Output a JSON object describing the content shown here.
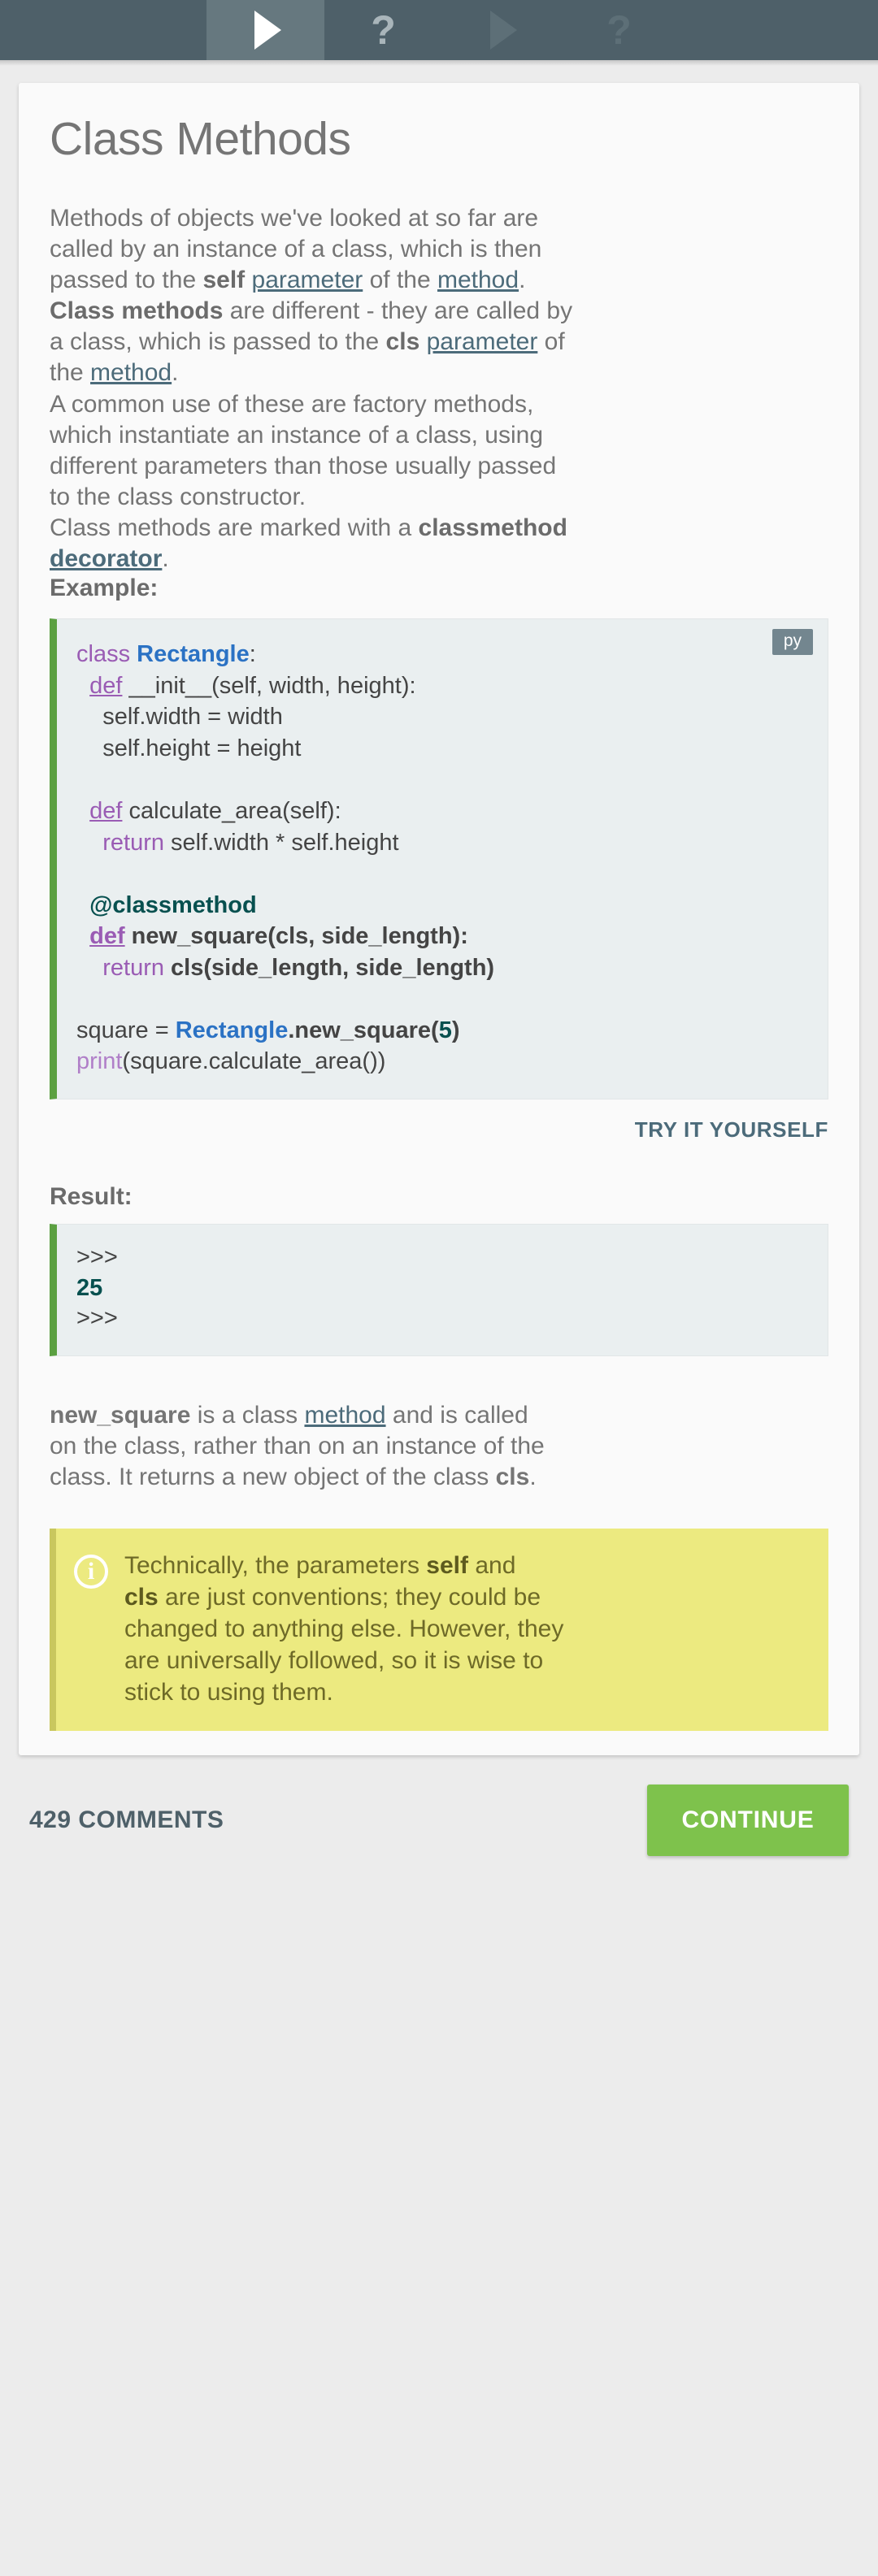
{
  "toolbar": {
    "tabs": [
      {
        "icon": "play-icon",
        "label": "Lesson",
        "active": true,
        "dimmed": false
      },
      {
        "icon": "question-icon",
        "label": "Quiz",
        "active": false,
        "dimmed": false
      },
      {
        "icon": "play-icon",
        "label": "Next Lesson",
        "active": false,
        "dimmed": true
      },
      {
        "icon": "question-icon",
        "label": "Next Quiz",
        "active": false,
        "dimmed": true
      }
    ]
  },
  "lesson": {
    "title": "Class Methods",
    "intro": {
      "l1": "Methods of objects we've looked at so far are",
      "l2": "called by an instance of a class, which is then",
      "l3_a": "passed to the ",
      "l3_self": "self",
      "l3_b": " ",
      "l3_param": "parameter",
      "l3_c": " of the ",
      "l3_method": "method",
      "l3_d": ".",
      "l4_classmethods": "Class methods",
      "l4_a": " are different - they are called by",
      "l5_a": "a class, which is passed to the ",
      "l5_cls": "cls",
      "l5_b": " ",
      "l5_param": "parameter",
      "l5_c": " of",
      "l6_a": "the ",
      "l6_method": "method",
      "l6_b": "."
    },
    "factory": {
      "l1": "A common use of these are factory methods,",
      "l2": "which instantiate an instance of a class, using",
      "l3": "different parameters than those usually passed",
      "l4": "to the class constructor.",
      "l5_a": "Class methods are marked with a ",
      "l5_classmethod": "classmethod",
      "l6_decorator": "decorator",
      "l6_b": "."
    },
    "example_label": "Example:",
    "code": {
      "lang_badge": "py",
      "lines": [
        {
          "kw": "class",
          "name": "Rectangle",
          "rest": ":"
        },
        {
          "kw": "def",
          "rest": " __init__(self, width, height):",
          "indent": 1
        },
        {
          "plain": "self.width = width",
          "indent": 2
        },
        {
          "plain": "self.height = height",
          "indent": 2
        },
        {
          "plain": "",
          "indent": 0
        },
        {
          "kw": "def",
          "rest": " calculate_area(self):",
          "indent": 1
        },
        {
          "kw2": "return",
          "rest": " self.width * self.height",
          "indent": 2
        },
        {
          "plain": "",
          "indent": 0
        },
        {
          "deco": "@classmethod",
          "indent": 1
        },
        {
          "kw": "def",
          "rest": " new_square(cls, side_length):",
          "indent": 1
        },
        {
          "kw2": "return",
          "rest": " cls(side_length, side_length)",
          "indent": 2
        },
        {
          "plain": "",
          "indent": 0
        },
        {
          "plain": "square = Rectangle.new_square(5)",
          "indent": 0
        },
        {
          "plain": "print(square.calculate_area())",
          "indent": 0
        }
      ]
    },
    "try_it_yourself": "TRY IT YOURSELF",
    "result_label": "Result:",
    "result_lines": [
      {
        "text": ">>>",
        "value": false
      },
      {
        "text": "25",
        "value": true
      },
      {
        "text": ">>>",
        "value": false
      }
    ],
    "explain": {
      "l1_name": "new_square",
      "l1_a": " is a class ",
      "l1_method": "method",
      "l1_b": " and is called",
      "l2": "on the class, rather than on an instance of the",
      "l3_a": "class. It returns a new object of the class ",
      "l3_cls": "cls",
      "l3_b": "."
    },
    "callout": {
      "icon": "info-icon",
      "l1_a": "Technically, the parameters ",
      "l1_self": "self",
      "l1_b": " and",
      "l2_cls": "cls",
      "l2_a": " are just conventions; they could be",
      "l3": "changed to anything else. However, they",
      "l4": "are universally followed, so it is wise to",
      "l5": "stick to using them."
    }
  },
  "footer": {
    "comments": "429 COMMENTS",
    "continue_label": "CONTINUE"
  },
  "colors": {
    "toolbar": "#4e6069",
    "toolbar_active": "#66787f",
    "accent_green": "#5ba041",
    "continue_green": "#7ec24c",
    "link": "#4c6b7a",
    "callout_bg": "#ecea80",
    "code_bg": "#eaeff0"
  }
}
